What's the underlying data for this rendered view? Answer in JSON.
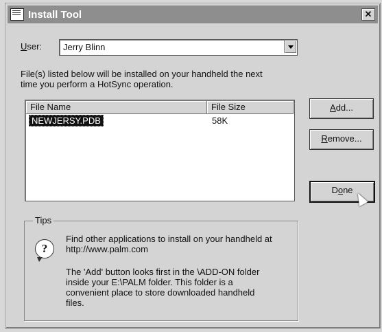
{
  "window": {
    "title": "Install Tool",
    "close_glyph": "✕",
    "icon": "palm-desktop-icon"
  },
  "user": {
    "label_first": "U",
    "label_rest": "ser:",
    "value": "Jerry Blinn"
  },
  "info_line1": "File(s) listed below will be installed on your handheld the next",
  "info_line2": "time you perform a HotSync operation.",
  "file_list": {
    "columns": [
      "File Name",
      "File Size"
    ],
    "rows": [
      {
        "name": "NEWJERSY.PDB",
        "size": "58K"
      }
    ]
  },
  "buttons": {
    "add_ul": "A",
    "add_rest": "dd...",
    "remove_ul": "R",
    "remove_rest": "emove...",
    "done_pre": "D",
    "done_ul": "o",
    "done_rest": "ne"
  },
  "tips": {
    "label": "Tips",
    "line1": "Find other applications to install on your handheld at",
    "line2": "http://www.palm.com",
    "line3": "The 'Add' button looks first in the \\ADD-ON folder",
    "line4": "inside your E:\\PALM folder. This folder is a",
    "line5": "convenient place to store downloaded handheld",
    "line6": "files.",
    "icon_glyph": "?"
  }
}
